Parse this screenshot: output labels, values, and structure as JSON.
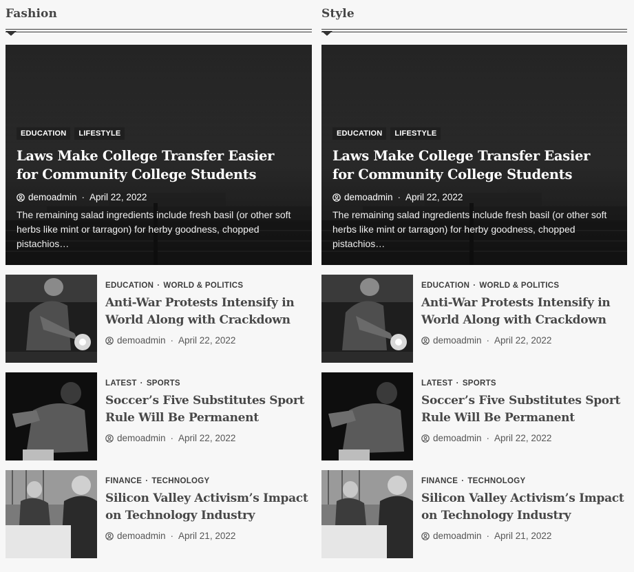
{
  "columns": [
    {
      "title": "Fashion",
      "featured": {
        "tags": [
          "EDUCATION",
          "LIFESTYLE"
        ],
        "title": "Laws Make College Transfer Easier for Community College Students",
        "author": "demoadmin",
        "date": "April 22, 2022",
        "excerpt": "The remaining salad ingredients include fresh basil (or other soft herbs like mint or tarragon) for herby goodness, chopped pistachios…"
      },
      "items": [
        {
          "cat1": "EDUCATION",
          "cat2": "WORLD & POLITICS",
          "title": "Anti-War Protests Intensify in World Along with Crackdown",
          "author": "demoadmin",
          "date": "April 22, 2022"
        },
        {
          "cat1": "LATEST",
          "cat2": "SPORTS",
          "title": "Soccer’s Five Substitutes Sport Rule Will Be Permanent",
          "author": "demoadmin",
          "date": "April 22, 2022"
        },
        {
          "cat1": "FINANCE",
          "cat2": "TECHNOLOGY",
          "title": "Silicon Valley Activism’s Impact on Technology Industry",
          "author": "demoadmin",
          "date": "April 21, 2022"
        }
      ]
    },
    {
      "title": "Style",
      "featured": {
        "tags": [
          "EDUCATION",
          "LIFESTYLE"
        ],
        "title": "Laws Make College Transfer Easier for Community College Students",
        "author": "demoadmin",
        "date": "April 22, 2022",
        "excerpt": "The remaining salad ingredients include fresh basil (or other soft herbs like mint or tarragon) for herby goodness, chopped pistachios…"
      },
      "items": [
        {
          "cat1": "EDUCATION",
          "cat2": "WORLD & POLITICS",
          "title": "Anti-War Protests Intensify in World Along with Crackdown",
          "author": "demoadmin",
          "date": "April 22, 2022"
        },
        {
          "cat1": "LATEST",
          "cat2": "SPORTS",
          "title": "Soccer’s Five Substitutes Sport Rule Will Be Permanent",
          "author": "demoadmin",
          "date": "April 22, 2022"
        },
        {
          "cat1": "FINANCE",
          "cat2": "TECHNOLOGY",
          "title": "Silicon Valley Activism’s Impact on Technology Industry",
          "author": "demoadmin",
          "date": "April 21, 2022"
        }
      ]
    }
  ],
  "meta_separator": "·",
  "icons": {
    "author": "user-circle-icon",
    "section_marker": "triangle-down-icon"
  },
  "colors": {
    "background": "#f7f7f7",
    "heading": "#454545",
    "tag_bg": "#1f1f1f"
  }
}
